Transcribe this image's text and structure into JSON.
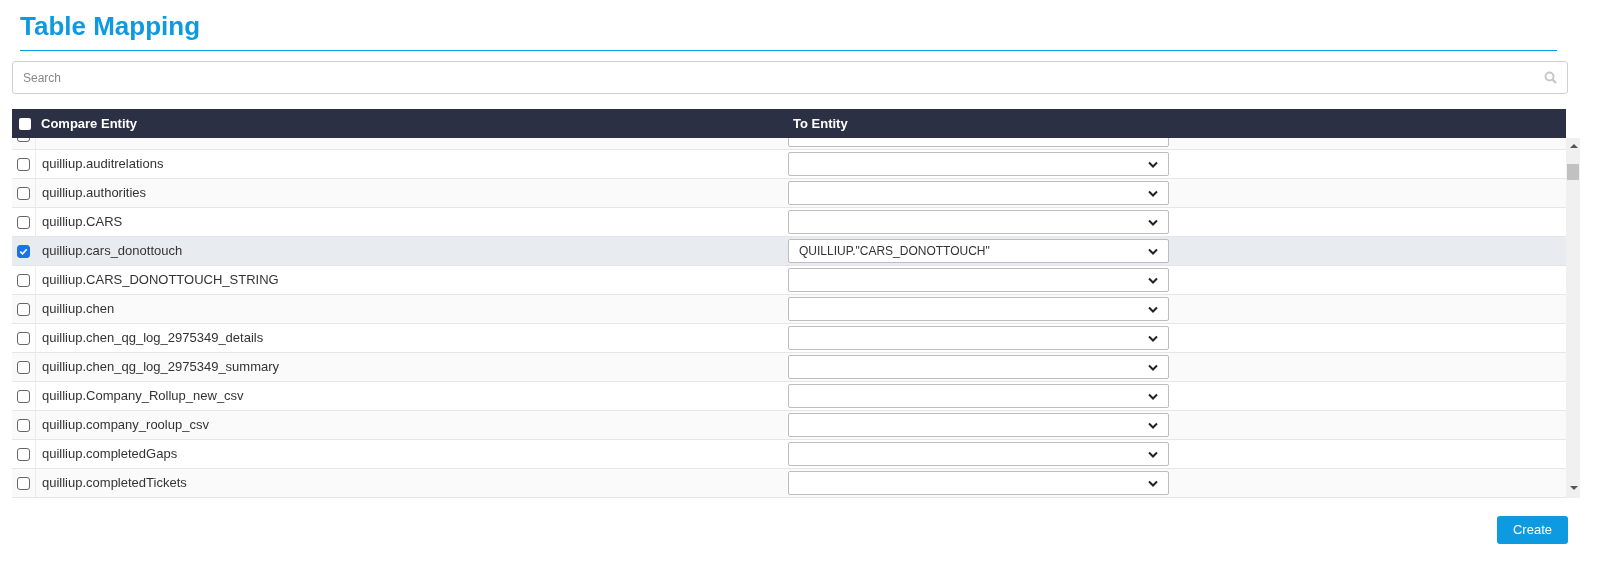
{
  "title": "Table Mapping",
  "search": {
    "placeholder": "Search"
  },
  "table": {
    "select_all": {
      "checked": false
    },
    "columns": [
      "Compare Entity",
      "To Entity"
    ],
    "rows": [
      {
        "kind": "partial",
        "checked": false
      },
      {
        "kind": "row",
        "name": "quilliup.auditrelations",
        "checked": false,
        "to": ""
      },
      {
        "kind": "row",
        "name": "quilliup.authorities",
        "checked": false,
        "to": ""
      },
      {
        "kind": "row",
        "name": "quilliup.CARS",
        "checked": false,
        "to": ""
      },
      {
        "kind": "row",
        "name": "quilliup.cars_donottouch",
        "checked": true,
        "to": "QUILLIUP.\"CARS_DONOTTOUCH\""
      },
      {
        "kind": "row",
        "name": "quilliup.CARS_DONOTTOUCH_STRING",
        "checked": false,
        "to": ""
      },
      {
        "kind": "row",
        "name": "quilliup.chen",
        "checked": false,
        "to": ""
      },
      {
        "kind": "row",
        "name": "quilliup.chen_qg_log_2975349_details",
        "checked": false,
        "to": ""
      },
      {
        "kind": "row",
        "name": "quilliup.chen_qg_log_2975349_summary",
        "checked": false,
        "to": ""
      },
      {
        "kind": "row",
        "name": "quilliup.Company_Rollup_new_csv",
        "checked": false,
        "to": ""
      },
      {
        "kind": "row",
        "name": "quilliup.company_roolup_csv",
        "checked": false,
        "to": ""
      },
      {
        "kind": "row",
        "name": "quilliup.completedGaps",
        "checked": false,
        "to": ""
      },
      {
        "kind": "row",
        "name": "quilliup.completedTickets",
        "checked": false,
        "to": ""
      }
    ]
  },
  "create_button": "Create"
}
